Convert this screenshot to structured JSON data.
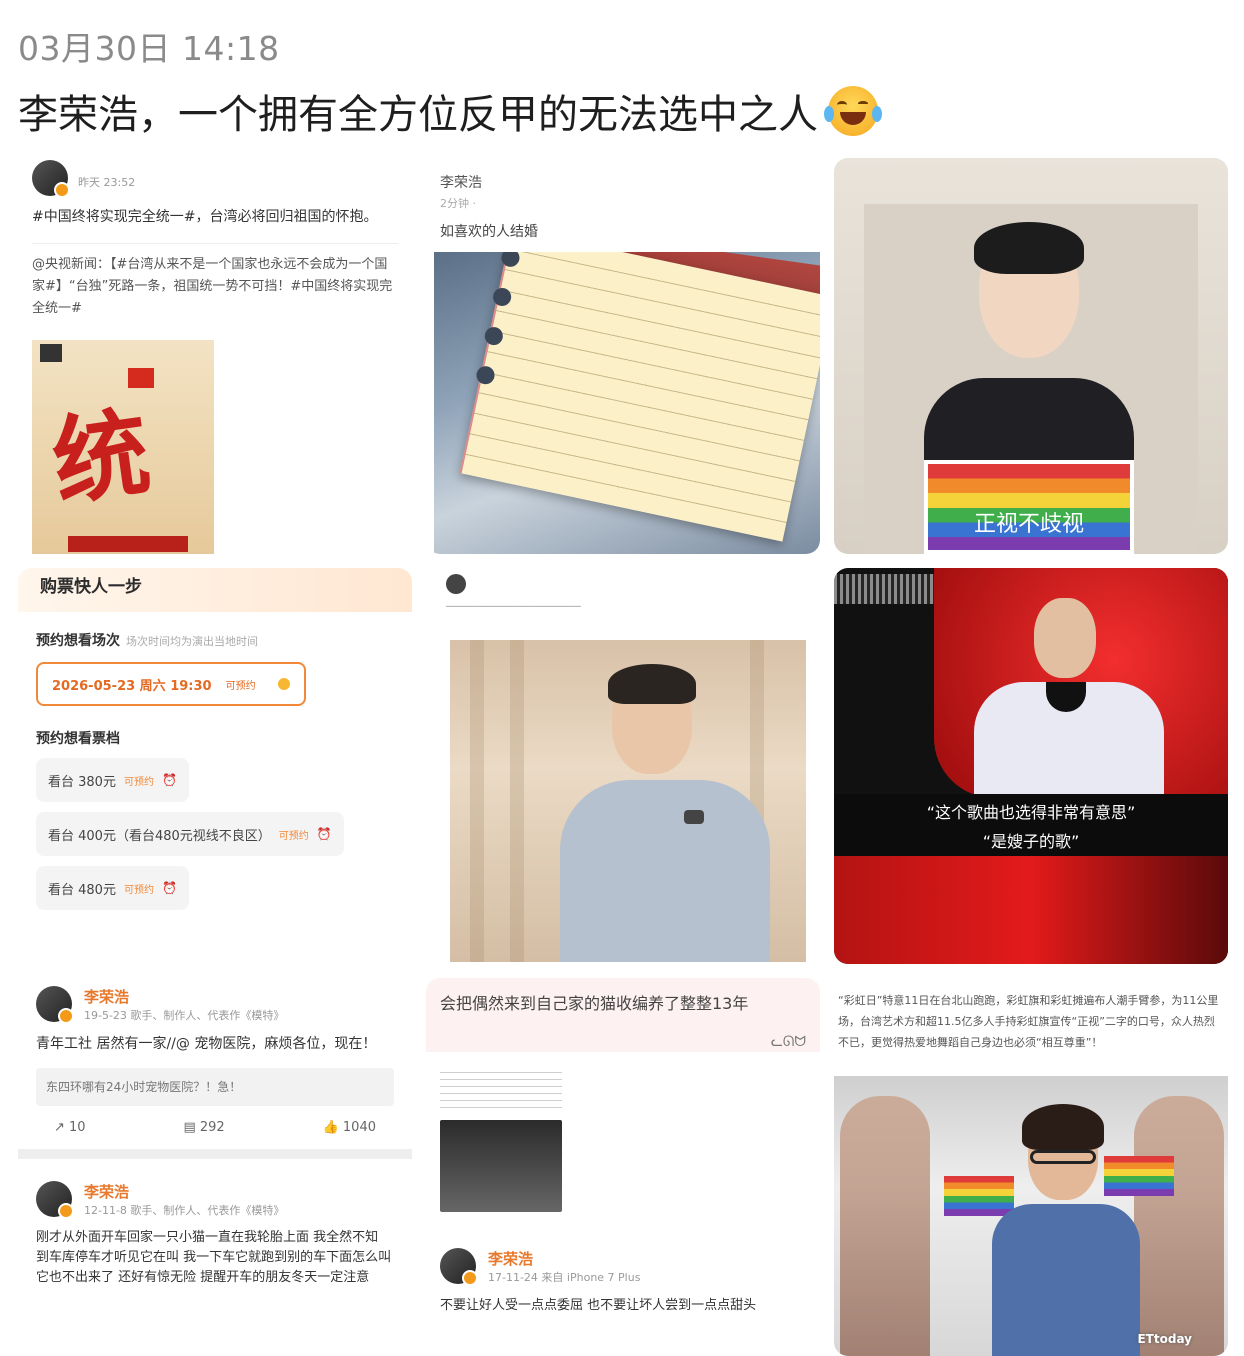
{
  "post": {
    "timestamp": "03月30日 14:18",
    "headline": "李荣浩，一个拥有全方位反甲的无法选中之人",
    "emoji": "laughing-tears-emoji"
  },
  "cells": {
    "c1": {
      "meta": "昨天 23:52",
      "body": "#中国终将实现完全统一#，台湾必将回归祖国的怀抱。",
      "quote": "@央视新闻：【#台湾从来不是一个国家也永远不会成为一个国家#】“台独”死路一条，祖国统一势不可挡！#中国终将实现完全统一#",
      "poster_char": "统"
    },
    "c2": {
      "name": "李荣浩",
      "meta": "2分钟 ·",
      "text": "如喜欢的人结婚"
    },
    "c3": {
      "sign": "正视不歧视"
    },
    "c4": {
      "title": "购票快人一步",
      "section1": "预约想看场次",
      "section1_note": "场次时间均为演出当地时间",
      "date": "2026-05-23 周六 19:30",
      "date_tag": "可预约",
      "section2": "预约想看票档",
      "tiers": [
        {
          "label": "看台 380元",
          "tag": "可预约"
        },
        {
          "label": "看台 400元（看台480元视线不良区）",
          "tag": "可预约"
        },
        {
          "label": "看台 480元",
          "tag": "可预约"
        }
      ]
    },
    "c6": {
      "caption1": "“这个歌曲也选得非常有意思”",
      "caption2": "“是嫂子的歌”"
    },
    "c7": {
      "name1": "李荣浩",
      "meta1": "19-5-23 歌手、制作人、代表作《模特》",
      "body1": "青年工社 居然有一家//@ 宠物医院，麻烦各位，现在！",
      "blur1": "东四环哪有24小时宠物医院？！急！",
      "actions": {
        "repost": "10",
        "comment": "292",
        "like": "1040"
      },
      "name2": "李荣浩",
      "meta2": "12-11-8 歌手、制作人、代表作《模特》",
      "body2": "刚才从外面开车回家一只小猫一直在我轮胎上面 我全然不知 到车库停车才听见它在叫 我一下车它就跑到别的车下面怎么叫它也不出来了 还好有惊无险 提醒开车的朋友冬天一定注意"
    },
    "c8": {
      "caption": "会把偶然来到自己家的猫收编养了整整13年",
      "name": "李荣浩",
      "meta": "17-11-24 来自 iPhone 7 Plus",
      "body": "不要让好人受一点点委屈 也不要让坏人尝到一点点甜头"
    },
    "c9": {
      "text": "“彩虹日”特意11日在台北山跑跑，彩虹旗和彩虹摊遍布人潮手臂参，为11公里场，台湾艺术方和超11.5亿多人手持彩虹旗宣传“正视”二字的口号，众人热烈不已，更觉得热爱地舞蹈自己身边也必须“相互尊重”！",
      "logo": "ETtoday"
    }
  }
}
